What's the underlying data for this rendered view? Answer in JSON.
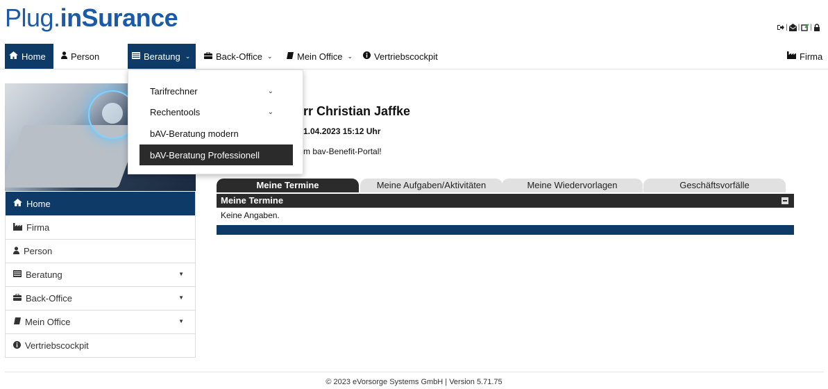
{
  "brand": {
    "part1": "Plug.",
    "part2": "inSurance"
  },
  "top_icons": [
    "logout-icon",
    "mail-icon",
    "edit-icon",
    "lock-icon"
  ],
  "nav": {
    "home": "Home",
    "person": "Person",
    "beratung": "Beratung",
    "back_office": "Back-Office",
    "mein_office": "Mein Office",
    "vertriebscockpit": "Vertriebscockpit",
    "firma": "Firma"
  },
  "dropdown": {
    "items": [
      "Tarifrechner",
      "Rechentools",
      "bAV-Beratung modern",
      "bAV-Beratung Professionell"
    ]
  },
  "sidebar": {
    "items": [
      "Home",
      "Firma",
      "Person",
      "Beratung",
      "Back-Office",
      "Mein Office",
      "Vertriebscockpit"
    ]
  },
  "main": {
    "greeting": "rr Christian Jaffke",
    "last_login": "1.04.2023 15:12 Uhr",
    "welcome": "m bav-Benefit-Portal!"
  },
  "tabs": [
    "Meine Termine",
    "Meine Aufgaben/Aktivitäten",
    "Meine Wiedervorlagen",
    "Geschäftsvorfälle"
  ],
  "panel": {
    "title": "Meine Termine",
    "empty": "Keine Angaben."
  },
  "footer": "© 2023 eVorsorge Systems GmbH | Version 5.71.75",
  "colors": {
    "brand_blue": "#1a5aa8",
    "nav_active": "#0d3a66",
    "dark_bar": "#2b2b2b"
  }
}
